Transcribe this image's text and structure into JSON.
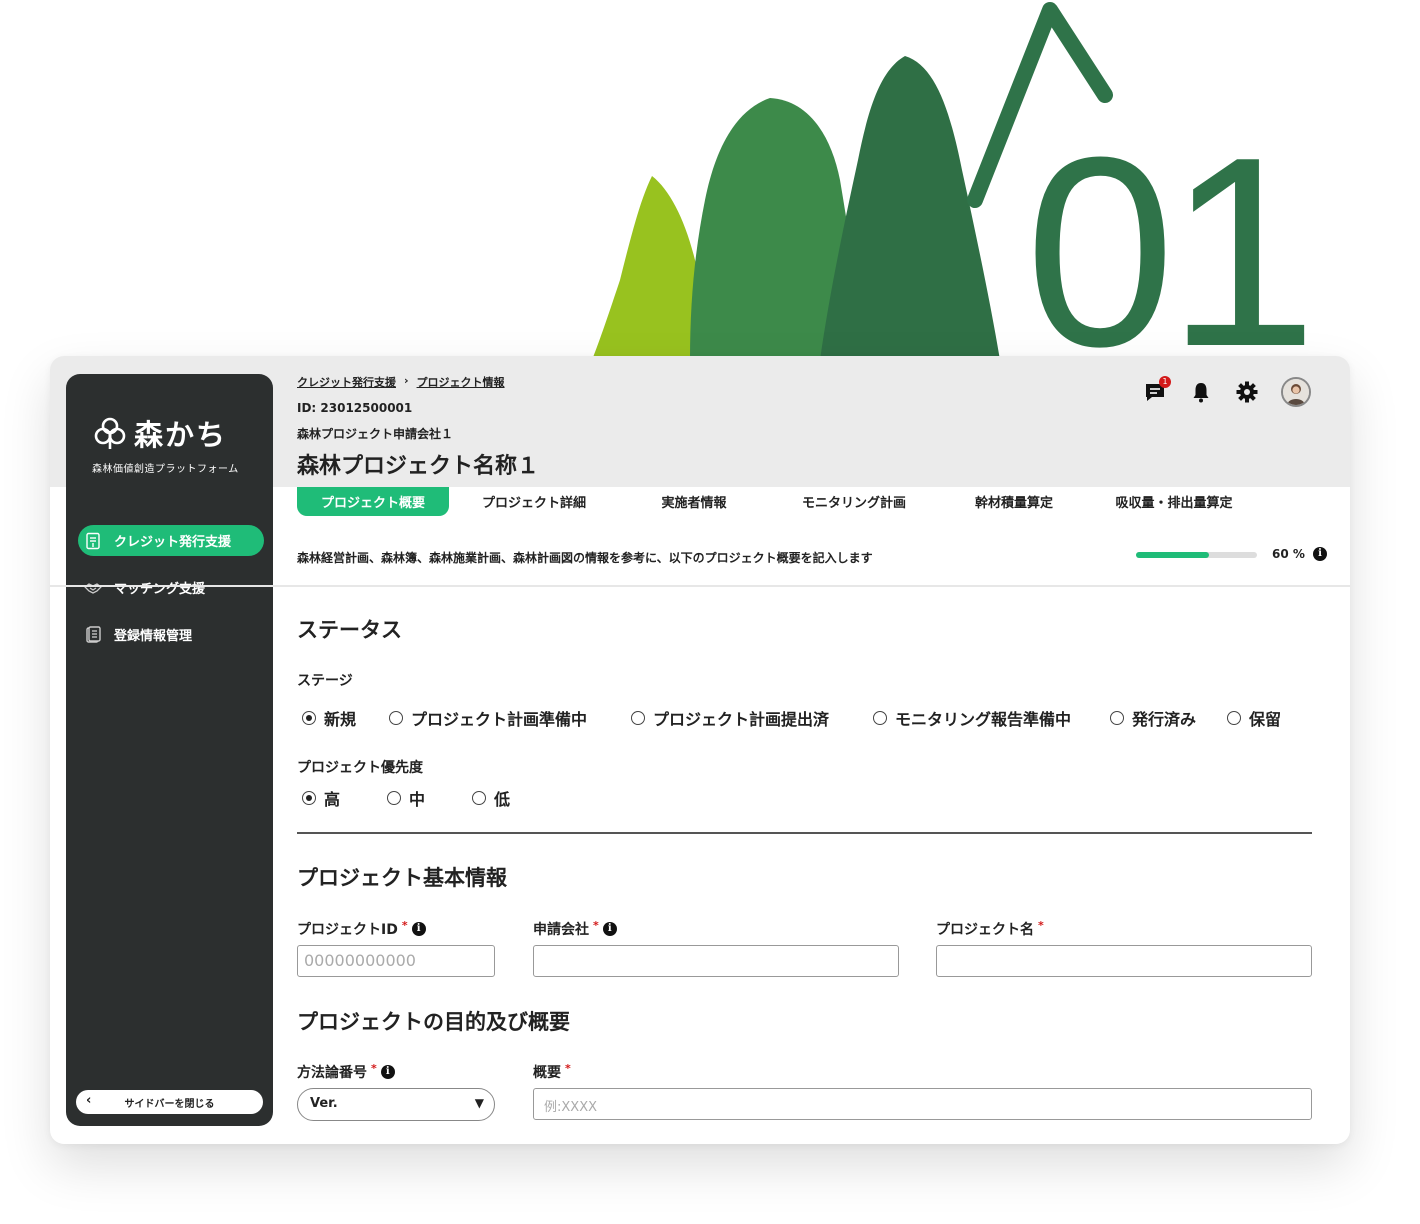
{
  "hero": {
    "number": "01"
  },
  "sidebar": {
    "logo_name": "森かち",
    "logo_sub": "森林価値創造プラットフォーム",
    "items": [
      {
        "label": "クレジット発行支援",
        "icon": "document-icon",
        "active": true
      },
      {
        "label": "マッチング支援",
        "icon": "handshake-icon",
        "active": false
      },
      {
        "label": "登録情報管理",
        "icon": "file-list-icon",
        "active": false
      }
    ],
    "close_label": "サイドバーを閉じる"
  },
  "header": {
    "breadcrumb": [
      "クレジット発行支援",
      "プロジェクト情報"
    ],
    "breadcrumb_sep": "›",
    "id_text": "ID: 23012500001",
    "company": "森林プロジェクト申請会社１",
    "title": "森林プロジェクト名称１",
    "notification_count": "1"
  },
  "tabs": [
    {
      "label": "プロジェクト概要",
      "active": true
    },
    {
      "label": "プロジェクト詳細",
      "active": false
    },
    {
      "label": "実施者情報",
      "active": false
    },
    {
      "label": "モニタリング計画",
      "active": false
    },
    {
      "label": "幹材積量算定",
      "active": false
    },
    {
      "label": "吸収量・排出量算定",
      "active": false
    }
  ],
  "tab_description": "森林経営計画、森林簿、森林施業計画、森林計画図の情報を参考に、以下のプロジェクト概要を記入します",
  "progress": {
    "value": 0.6,
    "label": "60 %"
  },
  "status": {
    "heading": "ステータス",
    "stage_label": "ステージ",
    "stages": [
      "新規",
      "プロジェクト計画準備中",
      "プロジェクト計画提出済",
      "モニタリング報告準備中",
      "発行済み",
      "保留"
    ],
    "stage_selected": 0,
    "priority_label": "プロジェクト優先度",
    "priorities": [
      "高",
      "中",
      "低"
    ],
    "priority_selected": 0
  },
  "basic": {
    "heading": "プロジェクト基本情報",
    "project_id_label": "プロジェクトID",
    "project_id_placeholder": "00000000000",
    "company_label": "申請会社",
    "name_label": "プロジェクト名",
    "required_mark": "*",
    "info_glyph": "i"
  },
  "purpose": {
    "heading": "プロジェクトの目的及び概要",
    "method_label": "方法論番号",
    "method_value": "Ver.",
    "summary_label": "概要",
    "summary_placeholder": "例:XXXX"
  },
  "colors": {
    "accent": "#1fbc78",
    "sidebar": "#2c2f2f",
    "forest_dark": "#2f6f45",
    "forest_mid": "#3e8a4a",
    "forest_light": "#98c21f"
  }
}
